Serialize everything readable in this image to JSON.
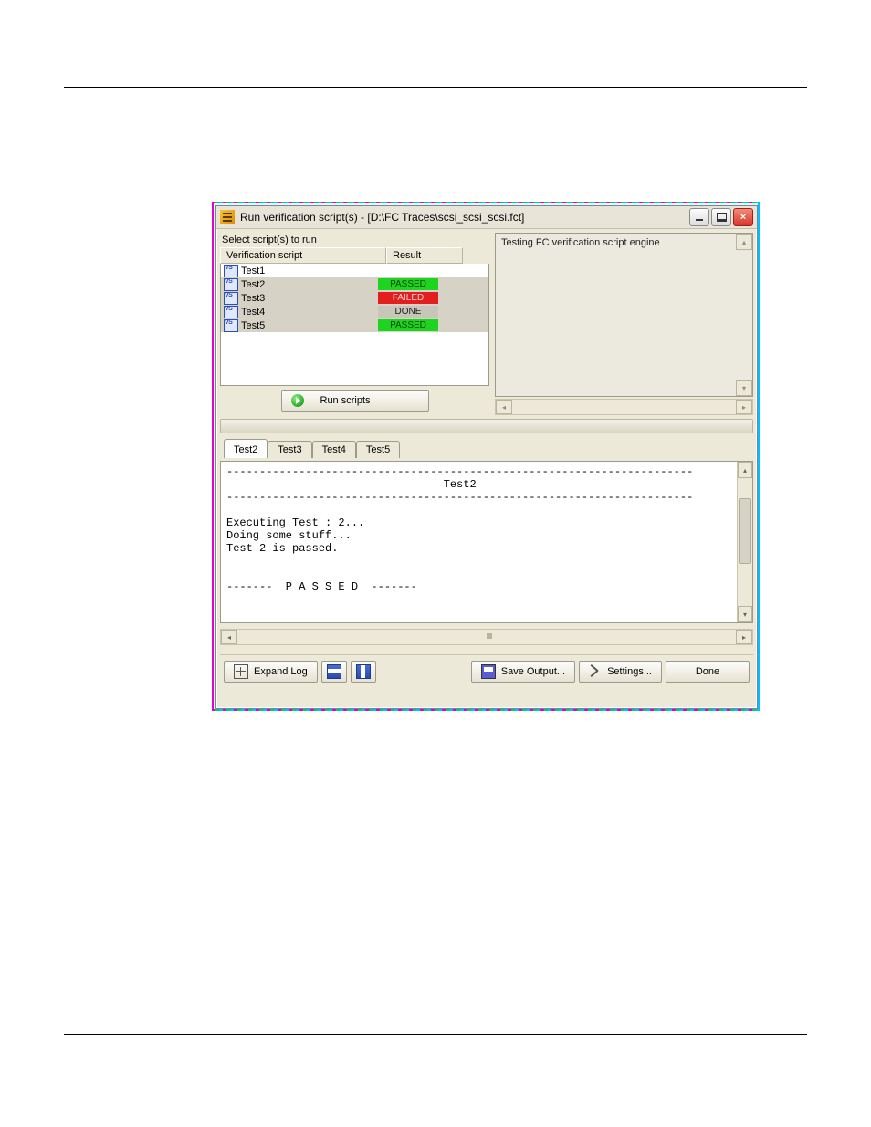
{
  "window": {
    "title": "Run verification script(s) - [D:\\FC Traces\\scsi_scsi_scsi.fct]"
  },
  "left": {
    "label": "Select script(s) to run",
    "col_script": "Verification script",
    "col_result": "Result",
    "run_label": "Run scripts"
  },
  "scripts": [
    {
      "name": "Test1",
      "result": "",
      "cls": "",
      "sel": false
    },
    {
      "name": "Test2",
      "result": "PASSED",
      "cls": "passed",
      "sel": true
    },
    {
      "name": "Test3",
      "result": "FAILED",
      "cls": "failed",
      "sel": true
    },
    {
      "name": "Test4",
      "result": "DONE",
      "cls": "done",
      "sel": true
    },
    {
      "name": "Test5",
      "result": "PASSED",
      "cls": "passed",
      "sel": true
    }
  ],
  "right_msg": "Testing FC verification script engine",
  "tabs": [
    "Test2",
    "Test3",
    "Test4",
    "Test5"
  ],
  "active_tab": 0,
  "log": "-----------------------------------------------------------------------\n                                 Test2\n-----------------------------------------------------------------------\n\nExecuting Test : 2...\nDoing some stuff...\nTest 2 is passed.\n\n\n-------  P A S S E D  -------",
  "bottom": {
    "expand": "Expand Log",
    "save": "Save Output...",
    "settings": "Settings...",
    "done": "Done"
  }
}
